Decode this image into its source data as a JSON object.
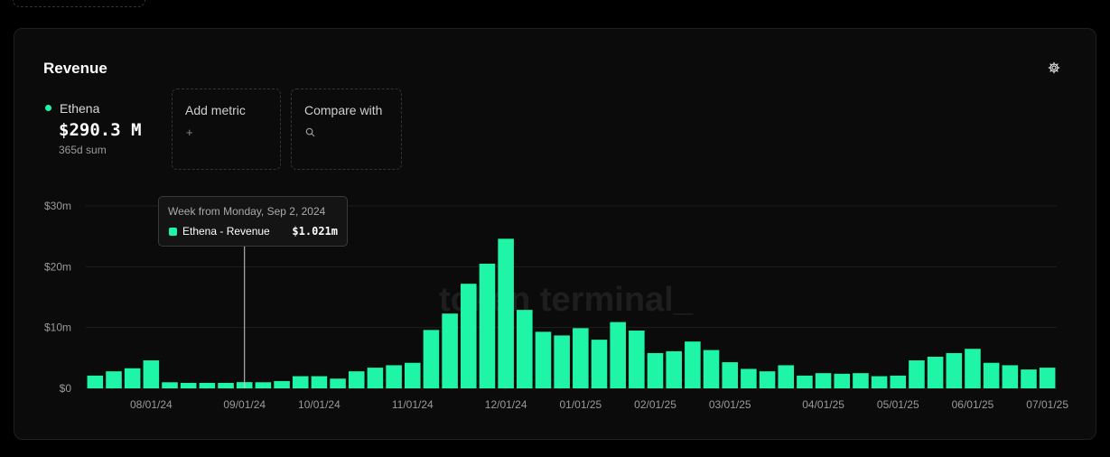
{
  "panel": {
    "title": "Revenue",
    "settings_icon": "gear-icon"
  },
  "metric": {
    "name": "Ethena",
    "value": "$290.3 M",
    "sub": "365d sum"
  },
  "add_metric": {
    "label": "Add metric",
    "icon": "+"
  },
  "compare": {
    "label": "Compare with",
    "icon": "search-icon"
  },
  "watermark": "token terminal_",
  "tooltip": {
    "header": "Week from Monday, Sep 2, 2024",
    "series": "Ethena - Revenue",
    "value": "$1.021m",
    "index": 8
  },
  "colors": {
    "accent": "#1ff5a6",
    "background": "#0b0b0b",
    "grid": "#222222",
    "text_muted": "#9a9a9a"
  },
  "chart_data": {
    "type": "bar",
    "ylim": [
      0,
      30
    ],
    "y_ticks": [
      "$0",
      "$10m",
      "$20m",
      "$30m"
    ],
    "y_tick_values": [
      0,
      10,
      20,
      30
    ],
    "x_tick_labels": [
      "08/01/24",
      "09/01/24",
      "10/01/24",
      "11/01/24",
      "12/01/24",
      "01/01/25",
      "02/01/25",
      "03/01/25",
      "04/01/25",
      "05/01/25",
      "06/01/25",
      "07/01/25"
    ],
    "x_tick_bar_index": [
      3,
      8,
      12,
      17,
      22,
      26,
      30,
      34,
      39,
      43,
      47,
      51
    ],
    "grid": true,
    "unit": "$m",
    "values": [
      2.1,
      2.8,
      3.3,
      4.6,
      1.0,
      0.9,
      0.9,
      0.9,
      1.021,
      1.0,
      1.2,
      2.0,
      2.0,
      1.6,
      2.8,
      3.4,
      3.8,
      4.2,
      9.6,
      12.3,
      17.2,
      20.5,
      24.6,
      12.9,
      9.3,
      8.7,
      9.9,
      8.0,
      10.9,
      9.5,
      5.8,
      6.1,
      7.7,
      6.3,
      4.3,
      3.2,
      2.8,
      3.8,
      2.1,
      2.5,
      2.4,
      2.5,
      2.0,
      2.1,
      4.6,
      5.2,
      5.8,
      6.5,
      4.2,
      3.8,
      3.1,
      3.4
    ]
  }
}
